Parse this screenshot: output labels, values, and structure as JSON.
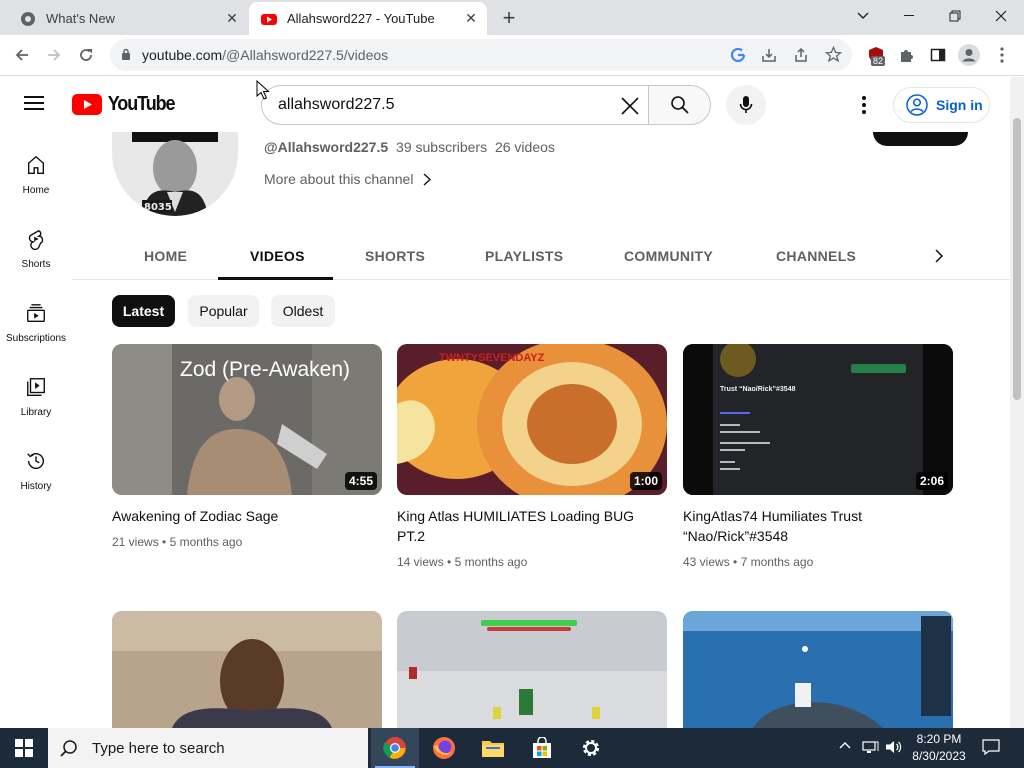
{
  "browser": {
    "tabs": [
      {
        "title": "What's New",
        "active": false
      },
      {
        "title": "Allahsword227 - YouTube",
        "active": true
      }
    ],
    "url_host": "youtube.com",
    "url_path": "/@Allahsword227.5/videos",
    "extension_badge": "82"
  },
  "youtube": {
    "logo_text": "YouTube",
    "search_query": "allahsword227.5",
    "sign_in_label": "Sign in",
    "accent_color": "#ff0000",
    "link_color": "#065fd4"
  },
  "sidebar": {
    "items": [
      {
        "label": "Home",
        "icon": "home-icon"
      },
      {
        "label": "Shorts",
        "icon": "shorts-icon"
      },
      {
        "label": "Subscriptions",
        "icon": "subscriptions-icon"
      },
      {
        "label": "Library",
        "icon": "library-icon"
      },
      {
        "label": "History",
        "icon": "history-icon"
      }
    ]
  },
  "channel": {
    "handle": "@Allahsword227.5",
    "subscribers": "39 subscribers",
    "videos": "26 videos",
    "more_label": "More about this channel"
  },
  "tabs": [
    "HOME",
    "VIDEOS",
    "SHORTS",
    "PLAYLISTS",
    "COMMUNITY",
    "CHANNELS"
  ],
  "selected_tab": "VIDEOS",
  "chips": [
    "Latest",
    "Popular",
    "Oldest"
  ],
  "selected_chip": "Latest",
  "videos": [
    {
      "title": "Awakening of Zodiac Sage",
      "views": "21 views",
      "age": "5 months ago",
      "duration": "4:55",
      "thumb_text": "Zod (Pre-Awaken)"
    },
    {
      "title": "King Atlas HUMILIATES Loading BUG PT.2",
      "views": "14 views",
      "age": "5 months ago",
      "duration": "1:00",
      "thumb_text": "TWNTYSEVENDAYZ"
    },
    {
      "title": "KingAtlas74 Humiliates Trust “Nao/Rick”#3548",
      "views": "43 views",
      "age": "7 months ago",
      "duration": "2:06",
      "thumb_text": "Trust “Nao/Rick”#3548"
    }
  ],
  "taskbar": {
    "search_placeholder": "Type here to search",
    "time": "8:20 PM",
    "date": "8/30/2023"
  }
}
